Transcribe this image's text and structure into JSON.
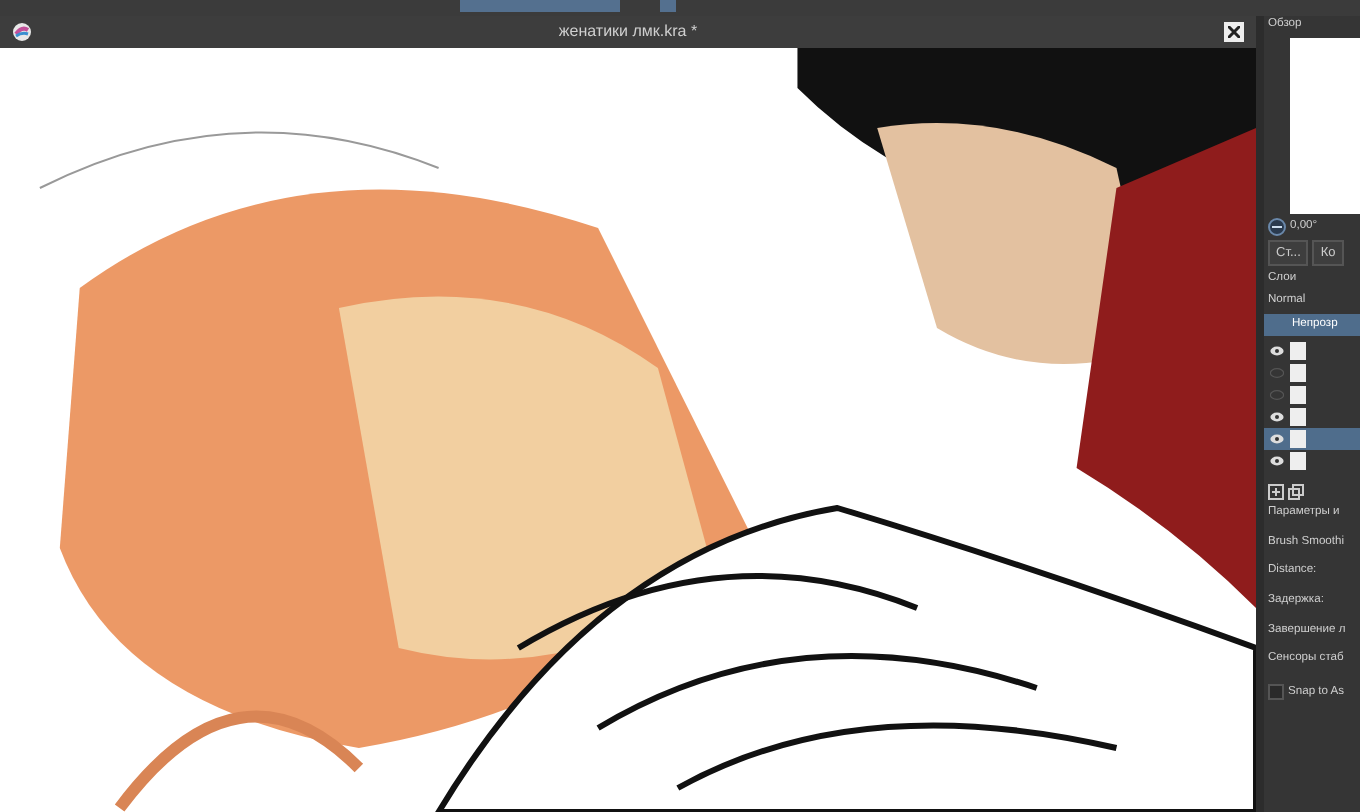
{
  "document": {
    "title": "женатики лмк.kra *"
  },
  "overview": {
    "title": "Обзор"
  },
  "rotation": {
    "value": "0,00°"
  },
  "view_buttons": [
    "Ст...",
    "Ко"
  ],
  "layers": {
    "title": "Слои",
    "blend_mode": "Normal",
    "opacity": {
      "label": "Непрозр",
      "level": 1
    },
    "items": [
      {
        "visible": true,
        "selected": false
      },
      {
        "visible": false,
        "selected": false
      },
      {
        "visible": false,
        "selected": false
      },
      {
        "visible": true,
        "selected": false
      },
      {
        "visible": true,
        "selected": true
      },
      {
        "visible": true,
        "selected": false
      }
    ]
  },
  "tool_options": {
    "title": "Параметры и",
    "rows": [
      "Brush Smoothi",
      "Distance:",
      "Задержка:",
      "Завершение л",
      "Сенсоры стаб"
    ],
    "snap": {
      "label": "Snap to As",
      "checked": false
    }
  }
}
